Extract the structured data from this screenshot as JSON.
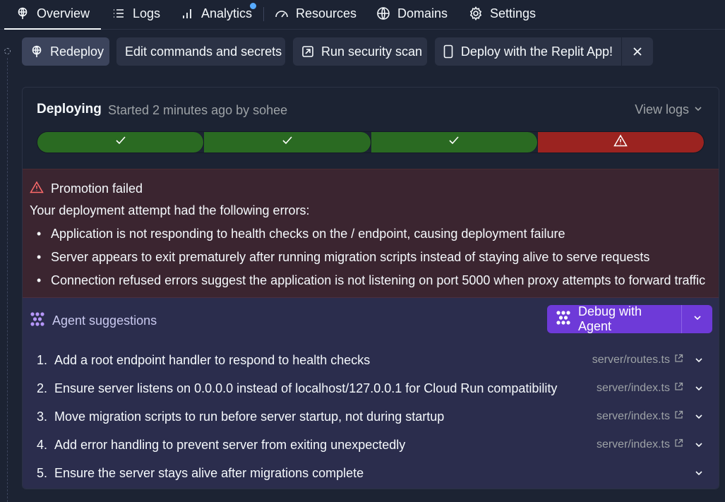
{
  "tabs": [
    {
      "label": "Overview",
      "icon": "globe-pin-icon",
      "active": true
    },
    {
      "label": "Logs",
      "icon": "list-icon"
    },
    {
      "label": "Analytics",
      "icon": "bar-chart-icon",
      "badge": true
    },
    {
      "label": "Resources",
      "icon": "gauge-icon"
    },
    {
      "label": "Domains",
      "icon": "globe-icon"
    },
    {
      "label": "Settings",
      "icon": "gear-icon"
    }
  ],
  "actions": {
    "redeploy": "Redeploy",
    "edit_commands": "Edit commands and secrets",
    "security_scan": "Run security scan",
    "deploy_app": "Deploy with the Replit App!"
  },
  "deployment": {
    "status": "Deploying",
    "started": "Started 2 minutes ago by sohee",
    "view_logs": "View logs",
    "stages": [
      "success",
      "success",
      "success",
      "failed"
    ]
  },
  "error": {
    "title": "Promotion failed",
    "intro": "Your deployment attempt had the following errors:",
    "items": [
      "Application is not responding to health checks on the / endpoint, causing deployment failure",
      "Server appears to exit prematurely after running migration scripts instead of staying alive to serve requests",
      "Connection refused errors suggest the application is not listening on port 5000 when proxy attempts to forward traffic"
    ]
  },
  "suggestions": {
    "title": "Agent suggestions",
    "debug_label": "Debug with Agent",
    "items": [
      {
        "num": "1.",
        "text": "Add a root endpoint handler to respond to health checks",
        "file": "server/routes.ts"
      },
      {
        "num": "2.",
        "text": "Ensure server listens on 0.0.0.0 instead of localhost/127.0.0.1 for Cloud Run compatibility",
        "file": "server/index.ts"
      },
      {
        "num": "3.",
        "text": "Move migration scripts to run before server startup, not during startup",
        "file": "server/index.ts"
      },
      {
        "num": "4.",
        "text": "Add error handling to prevent server from exiting unexpectedly",
        "file": "server/index.ts"
      },
      {
        "num": "5.",
        "text": "Ensure the server stays alive after migrations complete",
        "file": ""
      }
    ]
  },
  "colors": {
    "bg": "#1c2333",
    "success": "#2a6a22",
    "failure": "#9b2320",
    "agent": "#6e3ad8"
  }
}
